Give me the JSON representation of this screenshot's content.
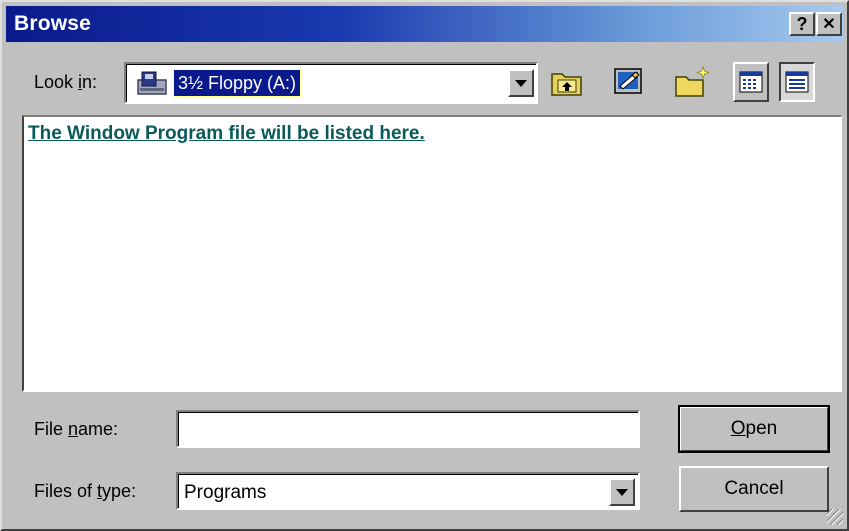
{
  "window": {
    "title": "Browse",
    "help_label": "?",
    "close_label": "✕"
  },
  "look_in": {
    "label_pre": "Look ",
    "label_mnemonic": "i",
    "label_post": "n:",
    "value": "3½ Floppy (A:)"
  },
  "toolbar": {
    "icons": [
      "up-one-level-icon",
      "desktop-icon",
      "new-folder-icon",
      "list-view-icon",
      "details-view-icon"
    ]
  },
  "file_list": {
    "note": "The Window Program file will be listed here."
  },
  "file_name": {
    "label_pre": "File ",
    "label_mnemonic": "n",
    "label_post": "ame:",
    "value": ""
  },
  "files_of_type": {
    "label_pre": "Files of ",
    "label_mnemonic": "t",
    "label_post": "ype:",
    "value": "Programs"
  },
  "buttons": {
    "open_mnemonic": "O",
    "open_rest": "pen",
    "cancel": "Cancel"
  }
}
